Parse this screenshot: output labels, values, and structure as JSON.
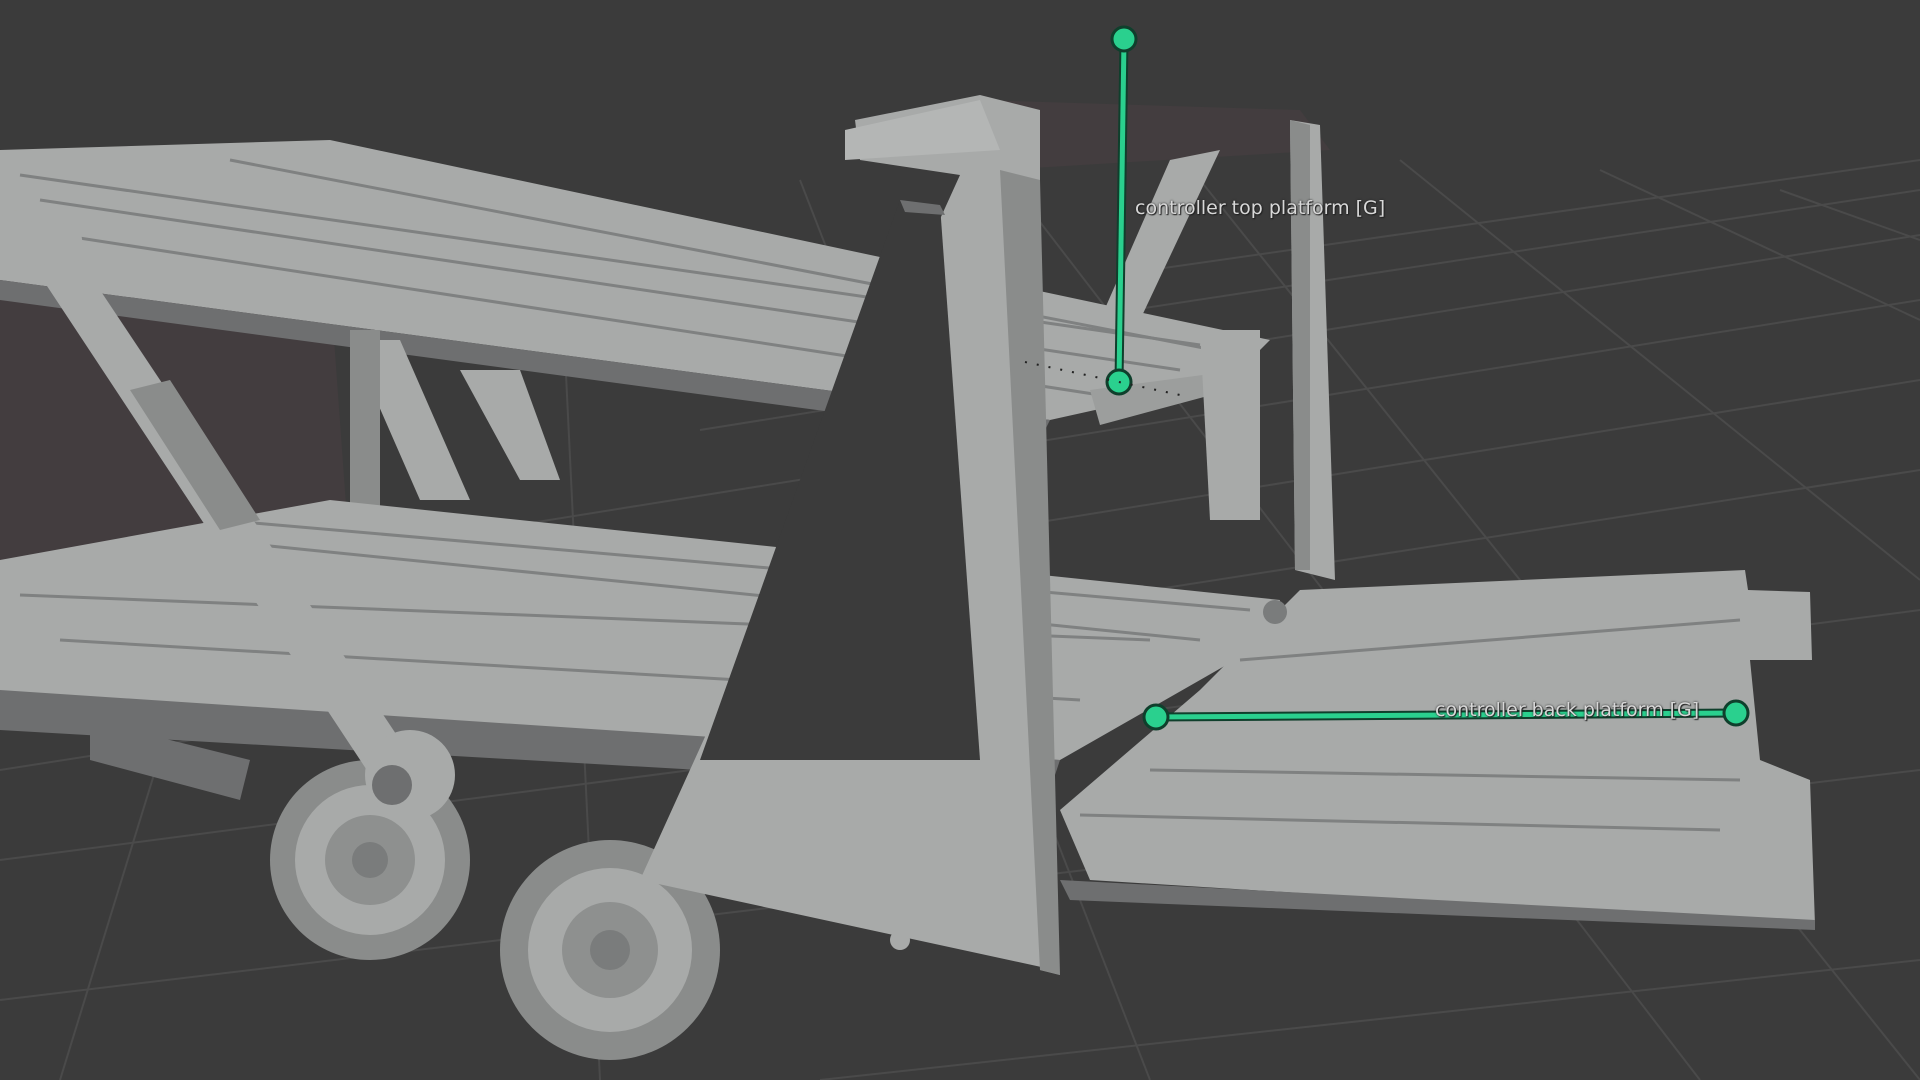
{
  "viewport": {
    "mode": "3d-viewport",
    "background_color": "#3b3b3b",
    "grid_line_color": "#4a4a4a",
    "model_fill_color": "#a8aaa9",
    "model_shadow_color": "#6e6f70",
    "model_dark_color": "#433d3f",
    "bone_color": "#2ad08e"
  },
  "bones": {
    "top_platform": {
      "label": "controller top platform [G]"
    },
    "back_platform": {
      "label": "controller back platform [G]"
    }
  }
}
